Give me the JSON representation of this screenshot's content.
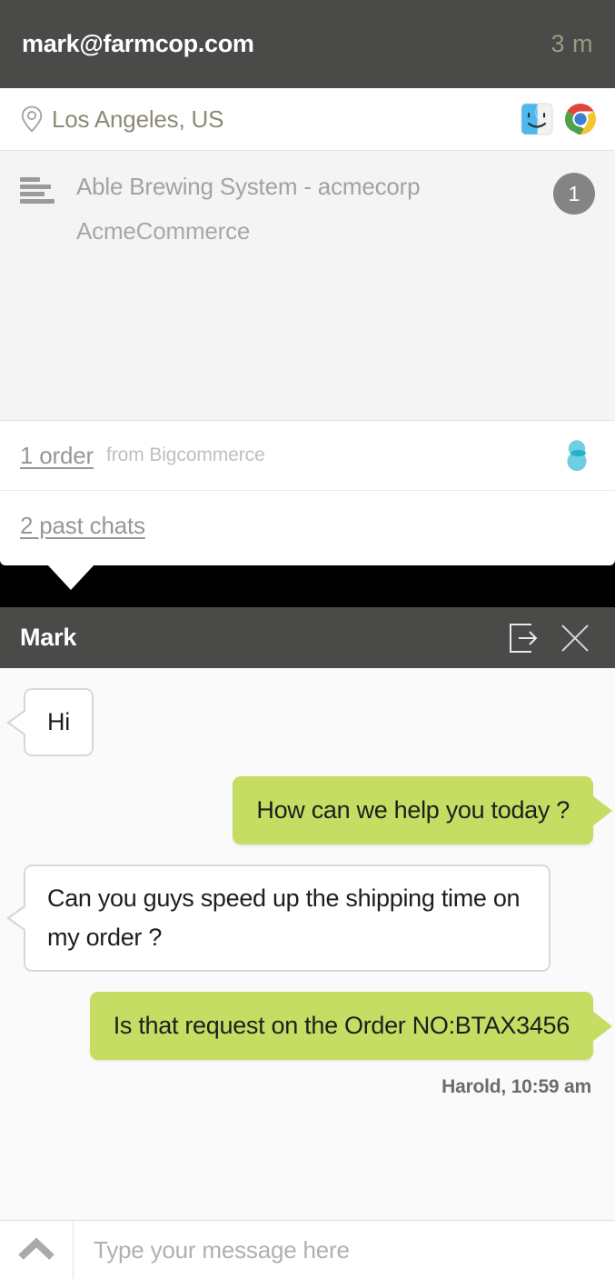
{
  "visitor": {
    "email": "mark@farmcop.com",
    "elapsed": "3 m",
    "location": "Los Angeles, US",
    "pin_icon": "map-pin-icon",
    "apps": [
      {
        "name": "finder-icon",
        "label": "Finder"
      },
      {
        "name": "chrome-icon",
        "label": "Google Chrome"
      }
    ],
    "page": {
      "list_icon": "list-lines-icon",
      "title": "Able Brewing System - acmecorp",
      "subtitle": "AcmeCommerce",
      "visit_count": "1"
    },
    "order": {
      "link": "1 order",
      "source": "from Bigcommerce",
      "logo_icon": "bigcommerce-logo-icon"
    },
    "past_chats": {
      "link": "2 past chats"
    }
  },
  "chat": {
    "agent_name": "Mark",
    "transfer_icon": "transfer-chat-icon",
    "close_icon": "close-icon",
    "messages": [
      {
        "direction": "in",
        "text": "Hi"
      },
      {
        "direction": "out",
        "text": "How can we help you today ?"
      },
      {
        "direction": "in",
        "text": "Can you guys speed up the shipping time on my order ?"
      },
      {
        "direction": "out",
        "text": "Is that request on the Order NO:BTAX3456"
      }
    ],
    "last_meta": "Harold, 10:59 am",
    "composer": {
      "placeholder": "Type your message here",
      "value": "",
      "toggle_icon": "chevron-up-icon"
    }
  },
  "colors": {
    "header_bg": "#4a4a48",
    "outgoing_bubble": "#c4dd62",
    "badge_bg": "#848484",
    "accent_time": "#9b9a82"
  }
}
